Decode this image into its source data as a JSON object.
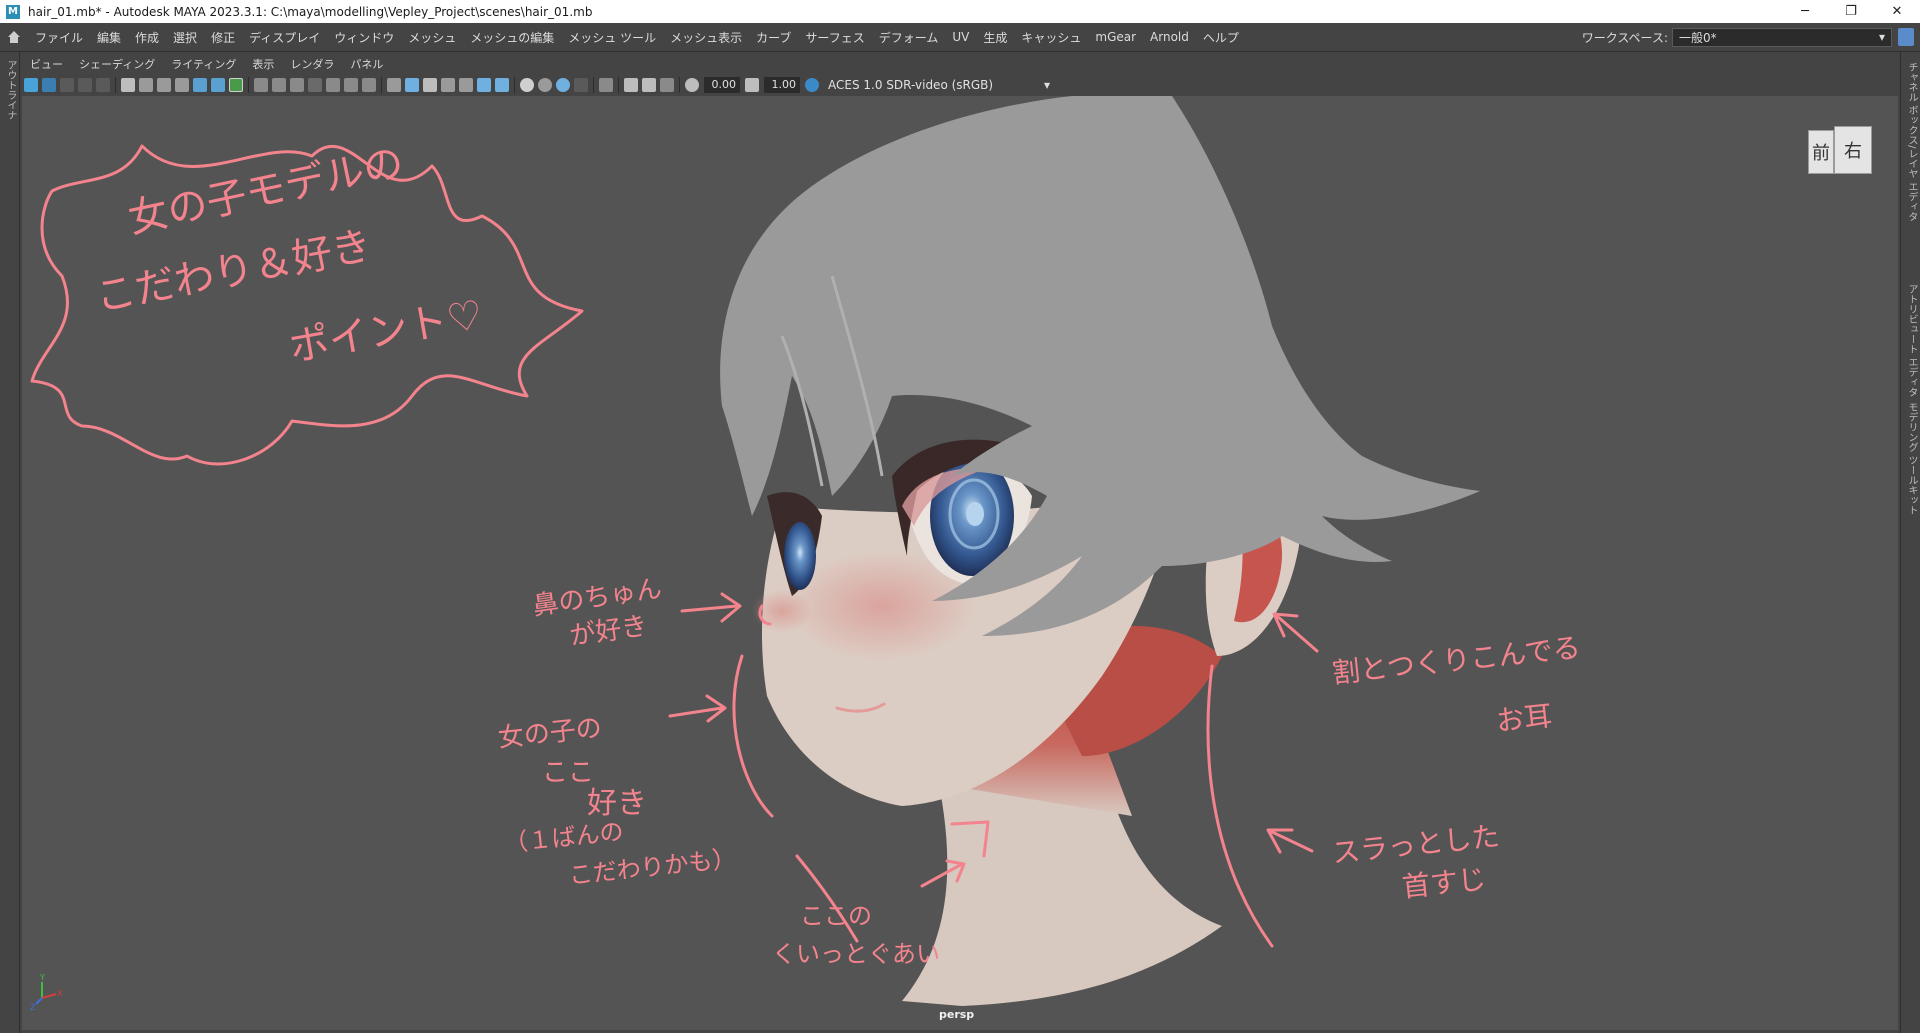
{
  "window": {
    "title": "hair_01.mb* - Autodesk MAYA 2023.3.1: C:\\maya\\modelling\\Vepley_Project\\scenes\\hair_01.mb",
    "minimize": "─",
    "maximize": "❐",
    "close": "✕"
  },
  "main_menu": {
    "items": [
      "ファイル",
      "編集",
      "作成",
      "選択",
      "修正",
      "ディスプレイ",
      "ウィンドウ",
      "メッシュ",
      "メッシュの編集",
      "メッシュ ツール",
      "メッシュ表示",
      "カーブ",
      "サーフェス",
      "デフォーム",
      "UV",
      "生成",
      "キャッシュ",
      "mGear",
      "Arnold",
      "ヘルプ"
    ],
    "workspace_label": "ワークスペース:",
    "workspace_value": "一般0*",
    "workspace_arrow": "▾"
  },
  "left_panel": {
    "label": "アウトライナ"
  },
  "right_tabs": [
    "チャネル ボックス/レイヤ エディタ",
    "アトリビュート エディタ",
    "モデリング ツールキット"
  ],
  "panel_menu": {
    "items": [
      "ビュー",
      "シェーディング",
      "ライティング",
      "表示",
      "レンダラ",
      "パネル"
    ]
  },
  "panel_toolbar": {
    "exposure": "0.00",
    "gamma": "1.00",
    "color_management": "ACES 1.0 SDR-video (sRGB)",
    "arrow": "▾"
  },
  "viewcube": {
    "front": "前",
    "right": "右"
  },
  "viewport": {
    "camera": "persp"
  },
  "annotations": {
    "title_lines": [
      "女の子モデルの",
      "こだわり＆好き",
      "ポイント♡"
    ],
    "nose": [
      "鼻のちゅん",
      "が好き"
    ],
    "cheek": [
      "女の子の",
      "ここ",
      "好き",
      "（１ばんの",
      "こだわりかも）"
    ],
    "chin": [
      "ここの",
      "くいっとぐあい"
    ],
    "ear": [
      "割とつくりこんでる",
      "お耳"
    ],
    "neck": [
      "スラっとした",
      "首すじ"
    ]
  },
  "colors": {
    "annotation": "#f3838d",
    "viewport_bg": "#545454",
    "hair": "#9a9a9a",
    "skin": "#d8c9c0",
    "shadow_red": "#b85048"
  }
}
